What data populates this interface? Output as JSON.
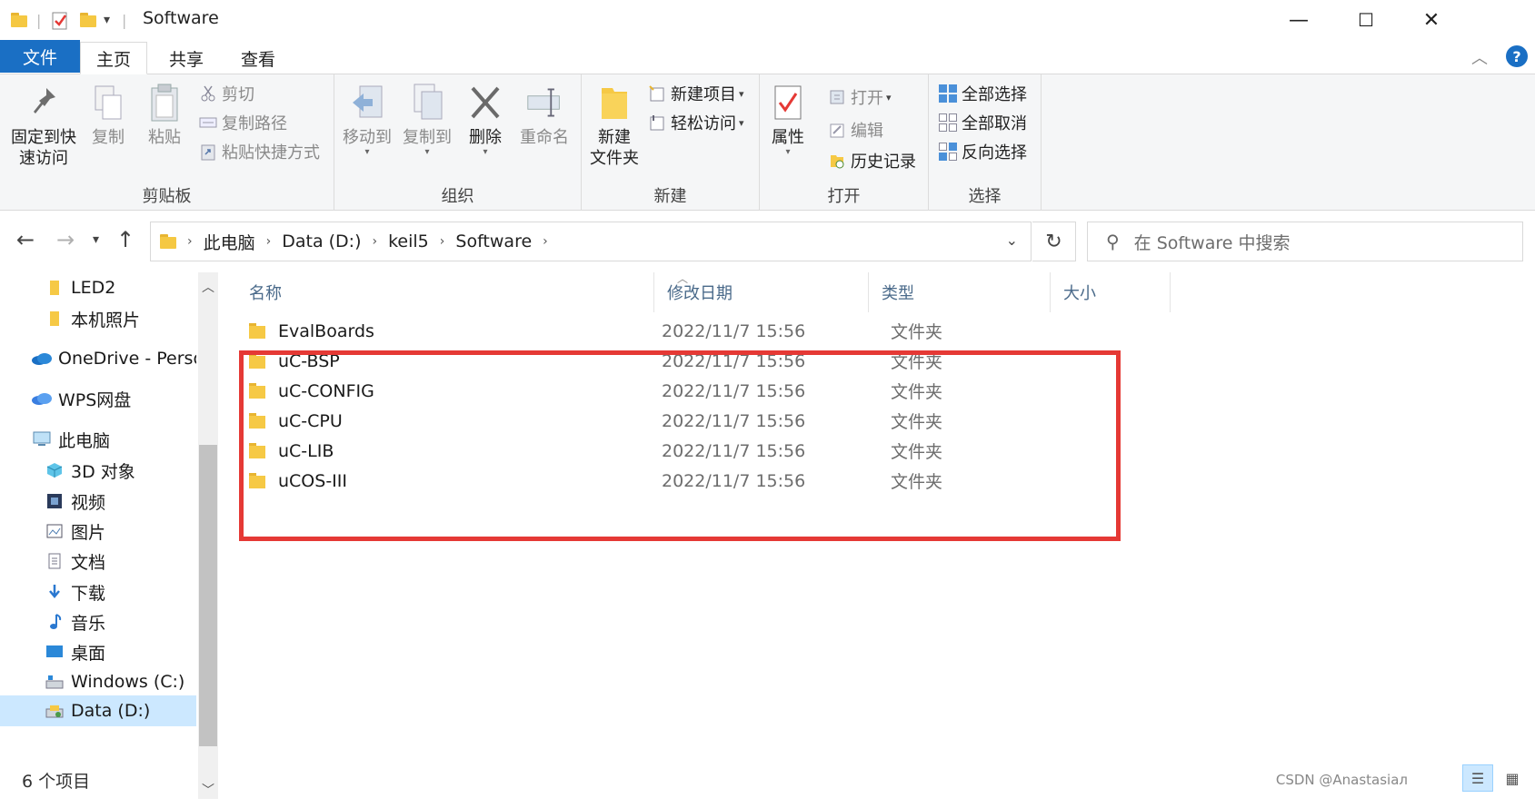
{
  "window": {
    "title": "Software",
    "minimize": "—",
    "maximize": "☐",
    "close": "✕"
  },
  "tabs": [
    {
      "label": "文件"
    },
    {
      "label": "主页"
    },
    {
      "label": "共享"
    },
    {
      "label": "查看"
    }
  ],
  "ribbon": {
    "clipboard": {
      "label": "剪贴板",
      "pin": "固定到快\n速访问",
      "copy": "复制",
      "paste": "粘贴",
      "cut": "剪切",
      "copy_path": "复制路径",
      "paste_shortcut": "粘贴快捷方式"
    },
    "organize": {
      "label": "组织",
      "move_to": "移动到",
      "copy_to": "复制到",
      "delete": "删除",
      "rename": "重命名"
    },
    "new": {
      "label": "新建",
      "new_folder": "新建\n文件夹",
      "new_item": "新建项目",
      "easy_access": "轻松访问"
    },
    "open": {
      "label": "打开",
      "properties": "属性",
      "open": "打开",
      "edit": "编辑",
      "history": "历史记录"
    },
    "select": {
      "label": "选择",
      "select_all": "全部选择",
      "select_none": "全部取消",
      "invert": "反向选择"
    }
  },
  "address": {
    "crumbs": [
      "此电脑",
      "Data (D:)",
      "keil5",
      "Software"
    ],
    "search_placeholder": "在 Software 中搜索"
  },
  "navpane": {
    "items": [
      {
        "label": "LED2",
        "icon": "folder-icon"
      },
      {
        "label": "本机照片",
        "icon": "folder-icon"
      },
      {
        "label": "OneDrive - Perso",
        "icon": "cloud-icon"
      },
      {
        "label": "WPS网盘",
        "icon": "cloud-icon"
      },
      {
        "label": "此电脑",
        "icon": "computer-icon"
      },
      {
        "label": "3D 对象",
        "icon": "cube-icon"
      },
      {
        "label": "视频",
        "icon": "video-icon"
      },
      {
        "label": "图片",
        "icon": "picture-icon"
      },
      {
        "label": "文档",
        "icon": "document-icon"
      },
      {
        "label": "下载",
        "icon": "download-icon"
      },
      {
        "label": "音乐",
        "icon": "music-icon"
      },
      {
        "label": "桌面",
        "icon": "desktop-icon"
      },
      {
        "label": "Windows (C:)",
        "icon": "drive-icon"
      },
      {
        "label": "Data (D:)",
        "icon": "drive-icon"
      }
    ]
  },
  "columns": {
    "name": "名称",
    "date": "修改日期",
    "type": "类型",
    "size": "大小"
  },
  "files": [
    {
      "name": "EvalBoards",
      "date": "2022/11/7 15:56",
      "type": "文件夹"
    },
    {
      "name": "uC-BSP",
      "date": "2022/11/7 15:56",
      "type": "文件夹"
    },
    {
      "name": "uC-CONFIG",
      "date": "2022/11/7 15:56",
      "type": "文件夹"
    },
    {
      "name": "uC-CPU",
      "date": "2022/11/7 15:56",
      "type": "文件夹"
    },
    {
      "name": "uC-LIB",
      "date": "2022/11/7 15:56",
      "type": "文件夹"
    },
    {
      "name": "uCOS-III",
      "date": "2022/11/7 15:56",
      "type": "文件夹"
    }
  ],
  "status": {
    "count": "6 个项目",
    "watermark": "CSDN @Anastasiaл"
  },
  "colors": {
    "accent": "#1a6fc4",
    "highlight_box": "#e53935",
    "folder": "#f6c945",
    "selected_bg": "#cce8ff"
  }
}
